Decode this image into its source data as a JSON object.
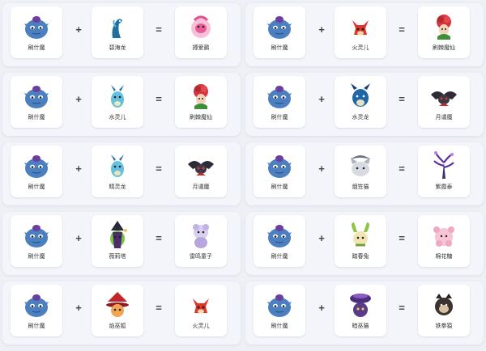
{
  "rows": [
    {
      "left": {
        "a": "刷什魔",
        "b": "碧海龙",
        "result": "搏爱鹂"
      },
      "right": {
        "a": "刷什魔",
        "b": "火灵儿",
        "result": "刷棘魔仙"
      }
    },
    {
      "left": {
        "a": "刷什魔",
        "b": "水灵儿",
        "result": "刷棘魔仙"
      },
      "right": {
        "a": "刷什魔",
        "b": "水灵龙",
        "result": "月谲魔"
      }
    },
    {
      "left": {
        "a": "刷什魔",
        "b": "精灵龙",
        "result": "月谲魔"
      },
      "right": {
        "a": "刷什魔",
        "b": "烟笠猫",
        "result": "紫霞泰"
      }
    },
    {
      "left": {
        "a": "刷什魔",
        "b": "薇莉塔",
        "result": "雷鸣童子"
      },
      "right": {
        "a": "刷什魔",
        "b": "踏春兔",
        "result": "棉花糖"
      }
    },
    {
      "left": {
        "a": "刷什魔",
        "b": "焰巫狐",
        "result": "火灵儿"
      },
      "right": {
        "a": "刷什魔",
        "b": "暗巫猫",
        "result": "铁拳猿"
      }
    }
  ],
  "operators": {
    "plus": "+",
    "equals": "="
  },
  "icons": {
    "creature_blue": "blue-imp-icon",
    "seadragon": "blue-seadragon-icon",
    "bird_pink": "pink-bird-icon",
    "fire_fox": "red-fox-icon",
    "rose": "rose-fairy-icon",
    "water_deer": "cyan-deer-icon",
    "bat": "dark-bat-icon",
    "gray_cat": "gray-cat-icon",
    "purple_tree": "purple-tree-icon",
    "green_witch": "green-witch-icon",
    "lilac_child": "lilac-child-icon",
    "leaf_rabbit": "leaf-rabbit-icon",
    "pink_bear": "pink-bear-icon",
    "red_hat_fox": "red-hat-fox-icon",
    "purple_cat": "purple-cat-icon",
    "monkey": "dark-monkey-icon"
  },
  "colors": {
    "background": "#eef0f6",
    "card": "#f4f5fa",
    "tile": "#ffffff",
    "imp_blue": "#4b7fc0"
  }
}
